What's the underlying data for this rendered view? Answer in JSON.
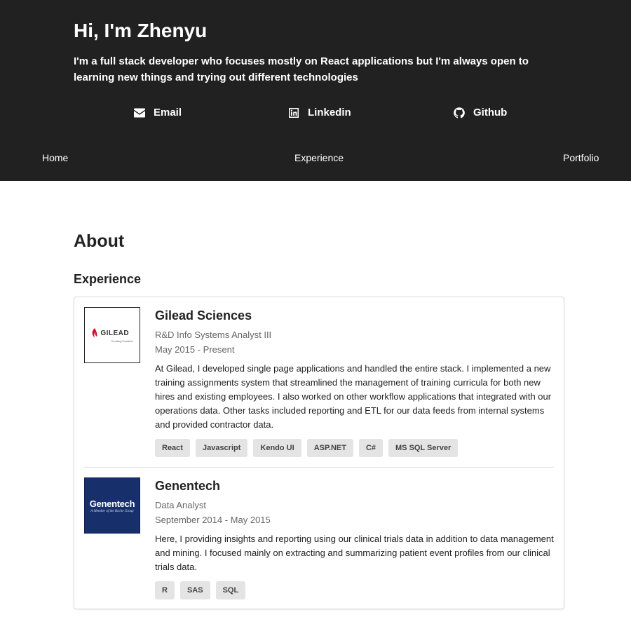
{
  "hero": {
    "title": "Hi, I'm Zhenyu",
    "subtitle": "I'm a full stack developer who focuses mostly on React applications but I'm always open to learning new things and trying out different technologies"
  },
  "links": [
    {
      "label": "Email",
      "icon": "envelope-icon"
    },
    {
      "label": "Linkedin",
      "icon": "linkedin-icon"
    },
    {
      "label": "Github",
      "icon": "github-icon"
    }
  ],
  "nav": [
    "Home",
    "Experience",
    "Portfolio"
  ],
  "about": {
    "title": "About",
    "experience_title": "Experience",
    "jobs": [
      {
        "company": "Gilead Sciences",
        "role": "R&D Info Systems Analyst III",
        "dates": "May 2015 - Present",
        "logo_text": "GILEAD",
        "logo_tagline": "Creating Possible",
        "description": "At Gilead, I developed single page applications and handled the entire stack. I implemented a new training assignments system that streamlined the management of training curricula for both new hires and existing employees. I also worked on other workflow applications that integrated with our operations data. Other tasks included reporting and ETL for our data feeds from internal systems and provided contractor data.",
        "tags": [
          "React",
          "Javascript",
          "Kendo UI",
          "ASP.NET",
          "C#",
          "MS SQL Server"
        ]
      },
      {
        "company": "Genentech",
        "role": "Data Analyst",
        "dates": "September 2014 - May 2015",
        "logo_text": "Genentech",
        "logo_tagline": "A Member of the Roche Group",
        "description": "Here, I providing insights and reporting using our clinical trials data in addition to data management and mining. I focused mainly on extracting and summarizing patient event profiles from our clinical trials data.",
        "tags": [
          "R",
          "SAS",
          "SQL"
        ]
      }
    ]
  },
  "colors": {
    "header_bg": "#212121",
    "tag_bg": "#e4e4e4",
    "gilead_red": "#c8102e",
    "genentech_blue": "#17306b"
  }
}
